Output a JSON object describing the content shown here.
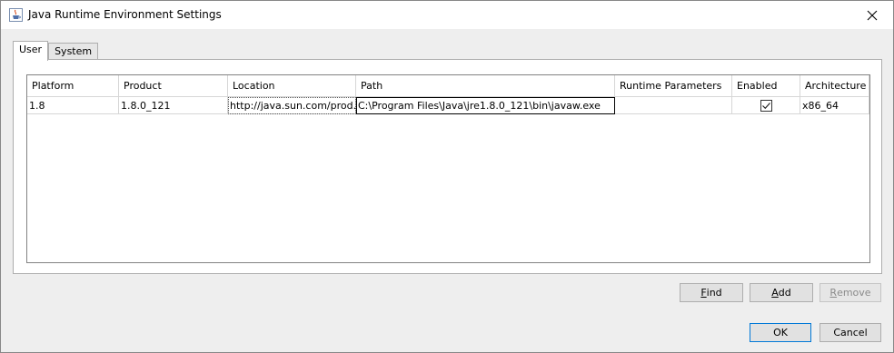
{
  "window": {
    "title": "Java Runtime Environment Settings"
  },
  "tabs": [
    {
      "label": "User",
      "active": true
    },
    {
      "label": "System",
      "active": false
    }
  ],
  "table": {
    "columns": [
      "Platform",
      "Product",
      "Location",
      "Path",
      "Runtime Parameters",
      "Enabled",
      "Architecture"
    ],
    "rows": [
      {
        "platform": "1.8",
        "product": "1.8.0_121",
        "location": "http://java.sun.com/prod...",
        "path": "C:\\Program Files\\Java\\jre1.8.0_121\\bin\\javaw.exe",
        "runtime_parameters": "",
        "enabled": true,
        "architecture": "x86_64"
      }
    ]
  },
  "buttons": {
    "find_mnemonic": "F",
    "find_rest": "ind",
    "add_mnemonic": "A",
    "add_rest": "dd",
    "remove_mnemonic": "R",
    "remove_rest": "emove",
    "ok": "OK",
    "cancel": "Cancel"
  }
}
